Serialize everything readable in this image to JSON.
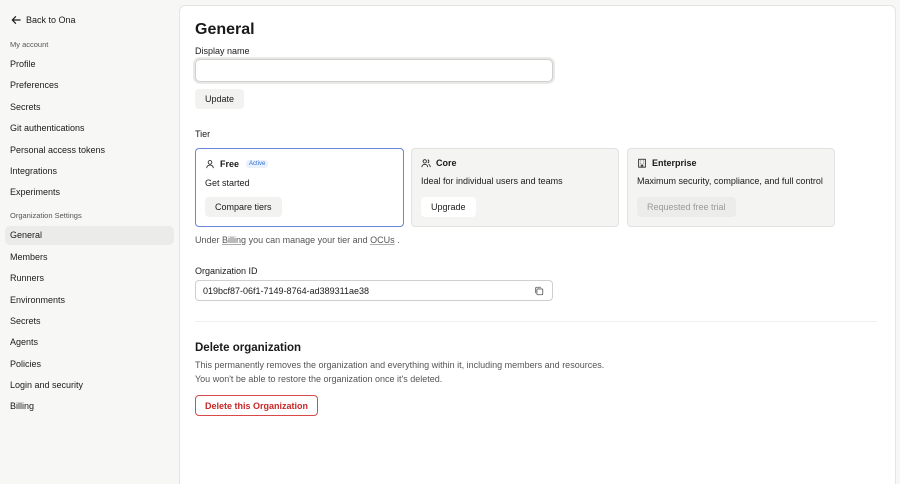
{
  "sidebar": {
    "back_label": "Back to Ona",
    "my_account_label": "My account",
    "account_items": [
      {
        "label": "Profile"
      },
      {
        "label": "Preferences"
      },
      {
        "label": "Secrets"
      },
      {
        "label": "Git authentications"
      },
      {
        "label": "Personal access tokens"
      },
      {
        "label": "Integrations"
      },
      {
        "label": "Experiments"
      }
    ],
    "org_label": "Organization Settings",
    "org_items": [
      {
        "label": "General",
        "active": true
      },
      {
        "label": "Members"
      },
      {
        "label": "Runners"
      },
      {
        "label": "Environments"
      },
      {
        "label": "Secrets"
      },
      {
        "label": "Agents"
      },
      {
        "label": "Policies"
      },
      {
        "label": "Login and security"
      },
      {
        "label": "Billing"
      }
    ]
  },
  "main": {
    "title": "General",
    "display_name": {
      "label": "Display name",
      "value": "",
      "update_label": "Update"
    },
    "tier": {
      "label": "Tier",
      "cards": [
        {
          "name": "Free",
          "badge": "Active",
          "description": "Get started",
          "button": "Compare tiers",
          "icon": "user-icon"
        },
        {
          "name": "Core",
          "description": "Ideal for individual users and teams",
          "button": "Upgrade",
          "icon": "users-icon"
        },
        {
          "name": "Enterprise",
          "description": "Maximum security, compliance, and full control",
          "button": "Requested free trial",
          "icon": "building-icon"
        }
      ],
      "note_prefix": "Under",
      "note_billing": "Billing",
      "note_middle": "you can manage your tier and",
      "note_ocus": "OCUs",
      "note_suffix": "."
    },
    "org_id": {
      "label": "Organization ID",
      "value": "019bcf87-06f1-7149-8764-ad389311ae38"
    },
    "delete": {
      "title": "Delete organization",
      "line1": "This permanently removes the organization and everything within it, including members and resources.",
      "line2": "You won't be able to restore the organization once it's deleted.",
      "button": "Delete this Organization"
    }
  },
  "colors": {
    "accent_border": "#6b86d6",
    "badge": "#2f6fd6",
    "danger": "#c62828"
  }
}
